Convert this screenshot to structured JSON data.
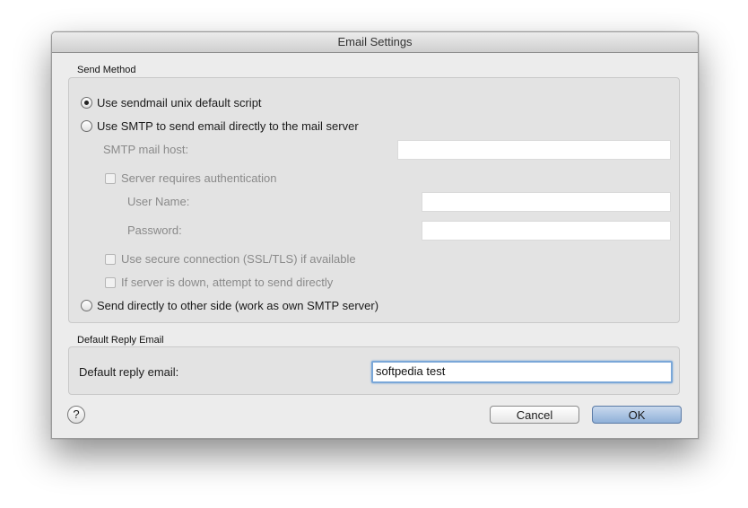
{
  "window": {
    "title": "Email Settings"
  },
  "send_method": {
    "label": "Send Method",
    "option_sendmail": "Use sendmail unix default script",
    "option_smtp": "Use SMTP to send email directly to the mail server",
    "smtp_host_label": "SMTP mail host:",
    "smtp_host_value": "",
    "auth_label": "Server requires authentication",
    "user_label": "User Name:",
    "user_value": "",
    "password_label": "Password:",
    "password_value": "",
    "ssl_label": "Use secure connection (SSL/TLS) if available",
    "fallback_label": "If server is down, attempt to send directly",
    "option_direct": "Send directly to other side (work as own SMTP server)",
    "selected": "sendmail"
  },
  "reply": {
    "label": "Default Reply Email",
    "field_label": "Default reply email:",
    "value": "softpedia test"
  },
  "buttons": {
    "help": "?",
    "cancel": "Cancel",
    "ok": "OK"
  }
}
